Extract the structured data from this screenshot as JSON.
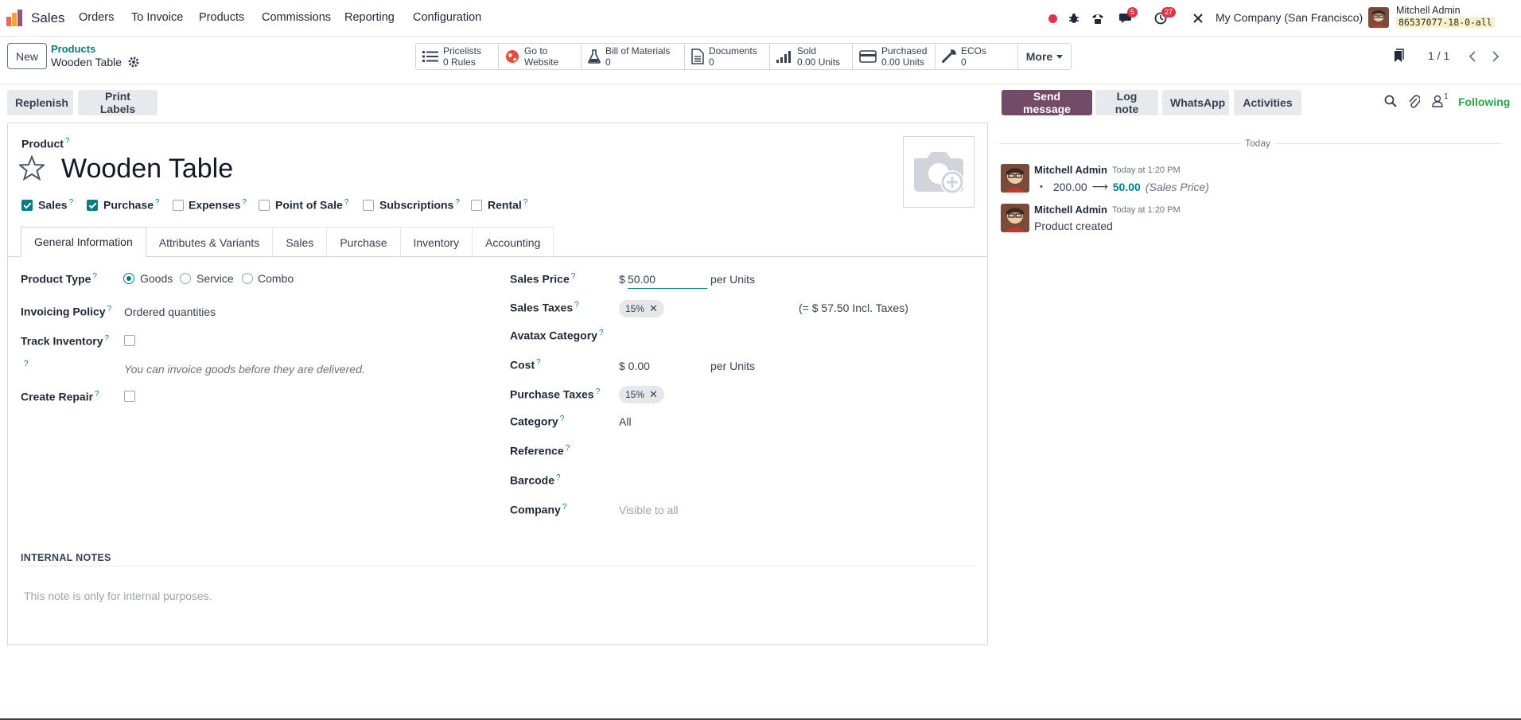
{
  "navbar": {
    "app_name": "Sales",
    "menu": [
      "Orders",
      "To Invoice",
      "Products",
      "Commissions",
      "Reporting",
      "Configuration"
    ],
    "chat_badge": "5",
    "activity_badge": "27",
    "company": "My Company (San Francisco)",
    "user": "Mitchell Admin",
    "db": "86537077-18-0-all"
  },
  "control": {
    "new_label": "New",
    "breadcrumb_parent": "Products",
    "breadcrumb_current": "Wooden Table",
    "stats": [
      {
        "line1": "Pricelists",
        "line2": "0 Rules",
        "icon": "list-icon"
      },
      {
        "line1": "Go to",
        "line2": "Website",
        "icon": "globe-icon"
      },
      {
        "line1": "Bill of Materials",
        "line2": "0",
        "icon": "flask-icon"
      },
      {
        "line1": "Documents",
        "line2": "0",
        "icon": "document-icon"
      },
      {
        "line1": "Sold",
        "line2": "0.00 Units",
        "icon": "signal-icon"
      },
      {
        "line1": "Purchased",
        "line2": "0.00 Units",
        "icon": "credit-card-icon"
      },
      {
        "line1": "ECOs",
        "line2": "0",
        "icon": "wrench-icon"
      }
    ],
    "more_label": "More",
    "pager": "1 / 1"
  },
  "statusbar": {
    "replenish": "Replenish",
    "print_labels": "Print Labels"
  },
  "form": {
    "product_label": "Product",
    "product_name": "Wooden Table",
    "options": [
      {
        "label": "Sales",
        "checked": true
      },
      {
        "label": "Purchase",
        "checked": true
      },
      {
        "label": "Expenses",
        "checked": false
      },
      {
        "label": "Point of Sale",
        "checked": false
      },
      {
        "label": "Subscriptions",
        "checked": false
      },
      {
        "label": "Rental",
        "checked": false
      }
    ],
    "tabs": [
      "General Information",
      "Attributes & Variants",
      "Sales",
      "Purchase",
      "Inventory",
      "Accounting"
    ],
    "product_type_label": "Product Type",
    "product_type_options": [
      "Goods",
      "Service",
      "Combo"
    ],
    "product_type_selected": "Goods",
    "invoicing_policy_label": "Invoicing Policy",
    "invoicing_policy_value": "Ordered quantities",
    "track_inventory_label": "Track Inventory",
    "invoice_hint": "You can invoice goods before they are delivered.",
    "create_repair_label": "Create Repair",
    "sales_price_label": "Sales Price",
    "sales_price_currency": "$",
    "sales_price_value": "50.00",
    "per_units": "per Units",
    "sales_taxes_label": "Sales Taxes",
    "sales_tax_tag": "15%",
    "incl_taxes": "(= $ 57.50 Incl. Taxes)",
    "avatax_label": "Avatax Category",
    "cost_label": "Cost",
    "cost_value": "$ 0.00",
    "purchase_taxes_label": "Purchase Taxes",
    "purchase_tax_tag": "15%",
    "category_label": "Category",
    "category_value": "All",
    "reference_label": "Reference",
    "barcode_label": "Barcode",
    "company_label": "Company",
    "company_placeholder": "Visible to all",
    "internal_notes_title": "INTERNAL NOTES",
    "internal_notes_placeholder": "This note is only for internal purposes."
  },
  "chatter": {
    "send_message": "Send message",
    "log_note": "Log note",
    "whatsapp": "WhatsApp",
    "activities": "Activities",
    "followers_count": "1",
    "following": "Following",
    "date_separator": "Today",
    "messages": [
      {
        "author": "Mitchell Admin",
        "date": "Today at 1:20 PM",
        "old_value": "200.00",
        "new_value": "50.00",
        "field": "(Sales Price)"
      },
      {
        "author": "Mitchell Admin",
        "date": "Today at 1:20 PM",
        "body": "Product created"
      }
    ]
  },
  "colors": {
    "brand": "#714b67",
    "link": "#017e84",
    "following": "#28a745",
    "badge": "#dc3545"
  }
}
